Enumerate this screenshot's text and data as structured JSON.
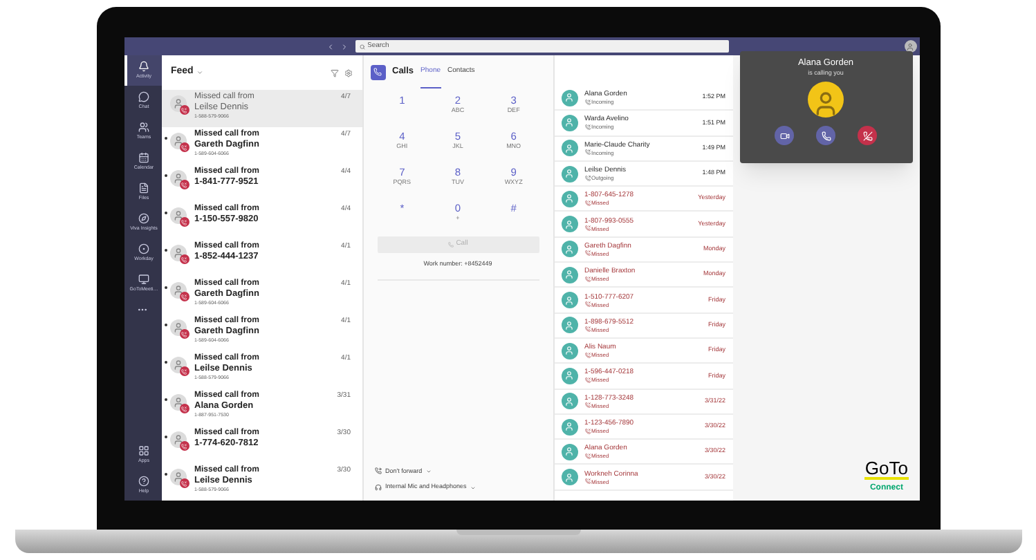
{
  "search": {
    "placeholder": "Search"
  },
  "rail": [
    {
      "label": "Activity",
      "selected": true
    },
    {
      "label": "Chat",
      "selected": false
    },
    {
      "label": "Teams",
      "selected": false
    },
    {
      "label": "Calendar",
      "selected": false
    },
    {
      "label": "Files",
      "selected": false
    },
    {
      "label": "Viva Insights",
      "selected": false
    },
    {
      "label": "Workday",
      "selected": false
    },
    {
      "label": "GoToMeeti…",
      "selected": false
    }
  ],
  "rail_bottom": [
    {
      "label": "Apps"
    },
    {
      "label": "Help"
    }
  ],
  "feed": {
    "title": "Feed",
    "items": [
      {
        "title": "Missed call from",
        "name": "Leilse Dennis",
        "number": "1-588-579-9066",
        "date": "4/7",
        "unread": false,
        "selected": true
      },
      {
        "title": "Missed call from",
        "name": "Gareth Dagfinn",
        "number": "1-589-604-6066",
        "date": "4/7",
        "unread": true,
        "selected": false
      },
      {
        "title": "Missed call from",
        "name": "1-841-777-9521",
        "date": "4/4",
        "unread": true,
        "selected": false
      },
      {
        "title": "Missed call from",
        "name": "1-150-557-9820",
        "date": "4/4",
        "unread": true,
        "selected": false
      },
      {
        "title": "Missed call from",
        "name": "1-852-444-1237",
        "date": "4/1",
        "unread": true,
        "selected": false
      },
      {
        "title": "Missed call from",
        "name": "Gareth Dagfinn",
        "number": "1-589-604-6066",
        "date": "4/1",
        "unread": true,
        "selected": false
      },
      {
        "title": "Missed call from",
        "name": "Gareth Dagfinn",
        "number": "1-589-604-6066",
        "date": "4/1",
        "unread": true,
        "selected": false
      },
      {
        "title": "Missed call from",
        "name": "Leilse Dennis",
        "number": "1-588-579-9066",
        "date": "4/1",
        "unread": true,
        "selected": false
      },
      {
        "title": "Missed call from",
        "name": "Alana Gorden",
        "number": "1-887-951-7530",
        "date": "3/31",
        "unread": true,
        "selected": false
      },
      {
        "title": "Missed call from",
        "name": "1-774-620-7812",
        "date": "3/30",
        "unread": true,
        "selected": false
      },
      {
        "title": "Missed call from",
        "name": "Leilse Dennis",
        "number": "1-588-579-9066",
        "date": "3/30",
        "unread": true,
        "selected": false
      }
    ]
  },
  "calls": {
    "title": "Calls",
    "tabs": [
      {
        "label": "Phone",
        "selected": true
      },
      {
        "label": "Contacts",
        "selected": false
      }
    ],
    "keys": [
      {
        "digit": "1"
      },
      {
        "digit": "2",
        "letters": "ABC"
      },
      {
        "digit": "3",
        "letters": "DEF"
      },
      {
        "digit": "4",
        "letters": "GHI"
      },
      {
        "digit": "5",
        "letters": "JKL"
      },
      {
        "digit": "6",
        "letters": "MNO"
      },
      {
        "digit": "7",
        "letters": "PQRS"
      },
      {
        "digit": "8",
        "letters": "TUV"
      },
      {
        "digit": "9",
        "letters": "WXYZ"
      },
      {
        "digit": "*"
      },
      {
        "digit": "0",
        "letters": "+"
      },
      {
        "digit": "#"
      }
    ],
    "call_button": {
      "label": "Call",
      "disabled": true
    },
    "work_number": "Work number: +8452449",
    "forward": "Don't forward",
    "audio_device": "Internal Mic and Headphones"
  },
  "history": [
    {
      "name": "Alana Gorden",
      "kind": "incoming",
      "status": "Incoming",
      "time": "1:52 PM"
    },
    {
      "name": "Warda Avelino",
      "kind": "incoming",
      "status": "Incoming",
      "time": "1:51 PM"
    },
    {
      "name": "Marie-Claude Charity",
      "kind": "incoming",
      "status": "Incoming",
      "time": "1:49 PM"
    },
    {
      "name": "Leilse Dennis",
      "kind": "outgoing",
      "status": "Outgoing",
      "time": "1:48 PM"
    },
    {
      "name": "1-807-645-1278",
      "kind": "missed",
      "status": "Missed",
      "time": "Yesterday"
    },
    {
      "name": "1-807-993-0555",
      "kind": "missed",
      "status": "Missed",
      "time": "Yesterday"
    },
    {
      "name": "Gareth Dagfinn",
      "kind": "missed",
      "status": "Missed",
      "time": "Monday"
    },
    {
      "name": "Danielle Braxton",
      "kind": "missed",
      "status": "Missed",
      "time": "Monday"
    },
    {
      "name": "1-510-777-6207",
      "kind": "missed",
      "status": "Missed",
      "time": "Friday"
    },
    {
      "name": "1-898-679-5512",
      "kind": "missed",
      "status": "Missed",
      "time": "Friday"
    },
    {
      "name": "Alis Naum",
      "kind": "missed",
      "status": "Missed",
      "time": "Friday"
    },
    {
      "name": "1-596-447-0218",
      "kind": "missed",
      "status": "Missed",
      "time": "Friday"
    },
    {
      "name": "1-128-773-3248",
      "kind": "missed",
      "status": "Missed",
      "time": "3/31/22"
    },
    {
      "name": "1-123-456-7890",
      "kind": "missed",
      "status": "Missed",
      "time": "3/30/22"
    },
    {
      "name": "Alana Gorden",
      "kind": "missed",
      "status": "Missed",
      "time": "3/30/22"
    },
    {
      "name": "Workneh Corinna",
      "kind": "missed",
      "status": "Missed",
      "time": "3/30/22"
    }
  ],
  "incoming_call": {
    "caller": "Alana Gorden",
    "subtitle": "is calling you"
  },
  "logo": {
    "word": "GoTo",
    "product": "Connect"
  }
}
